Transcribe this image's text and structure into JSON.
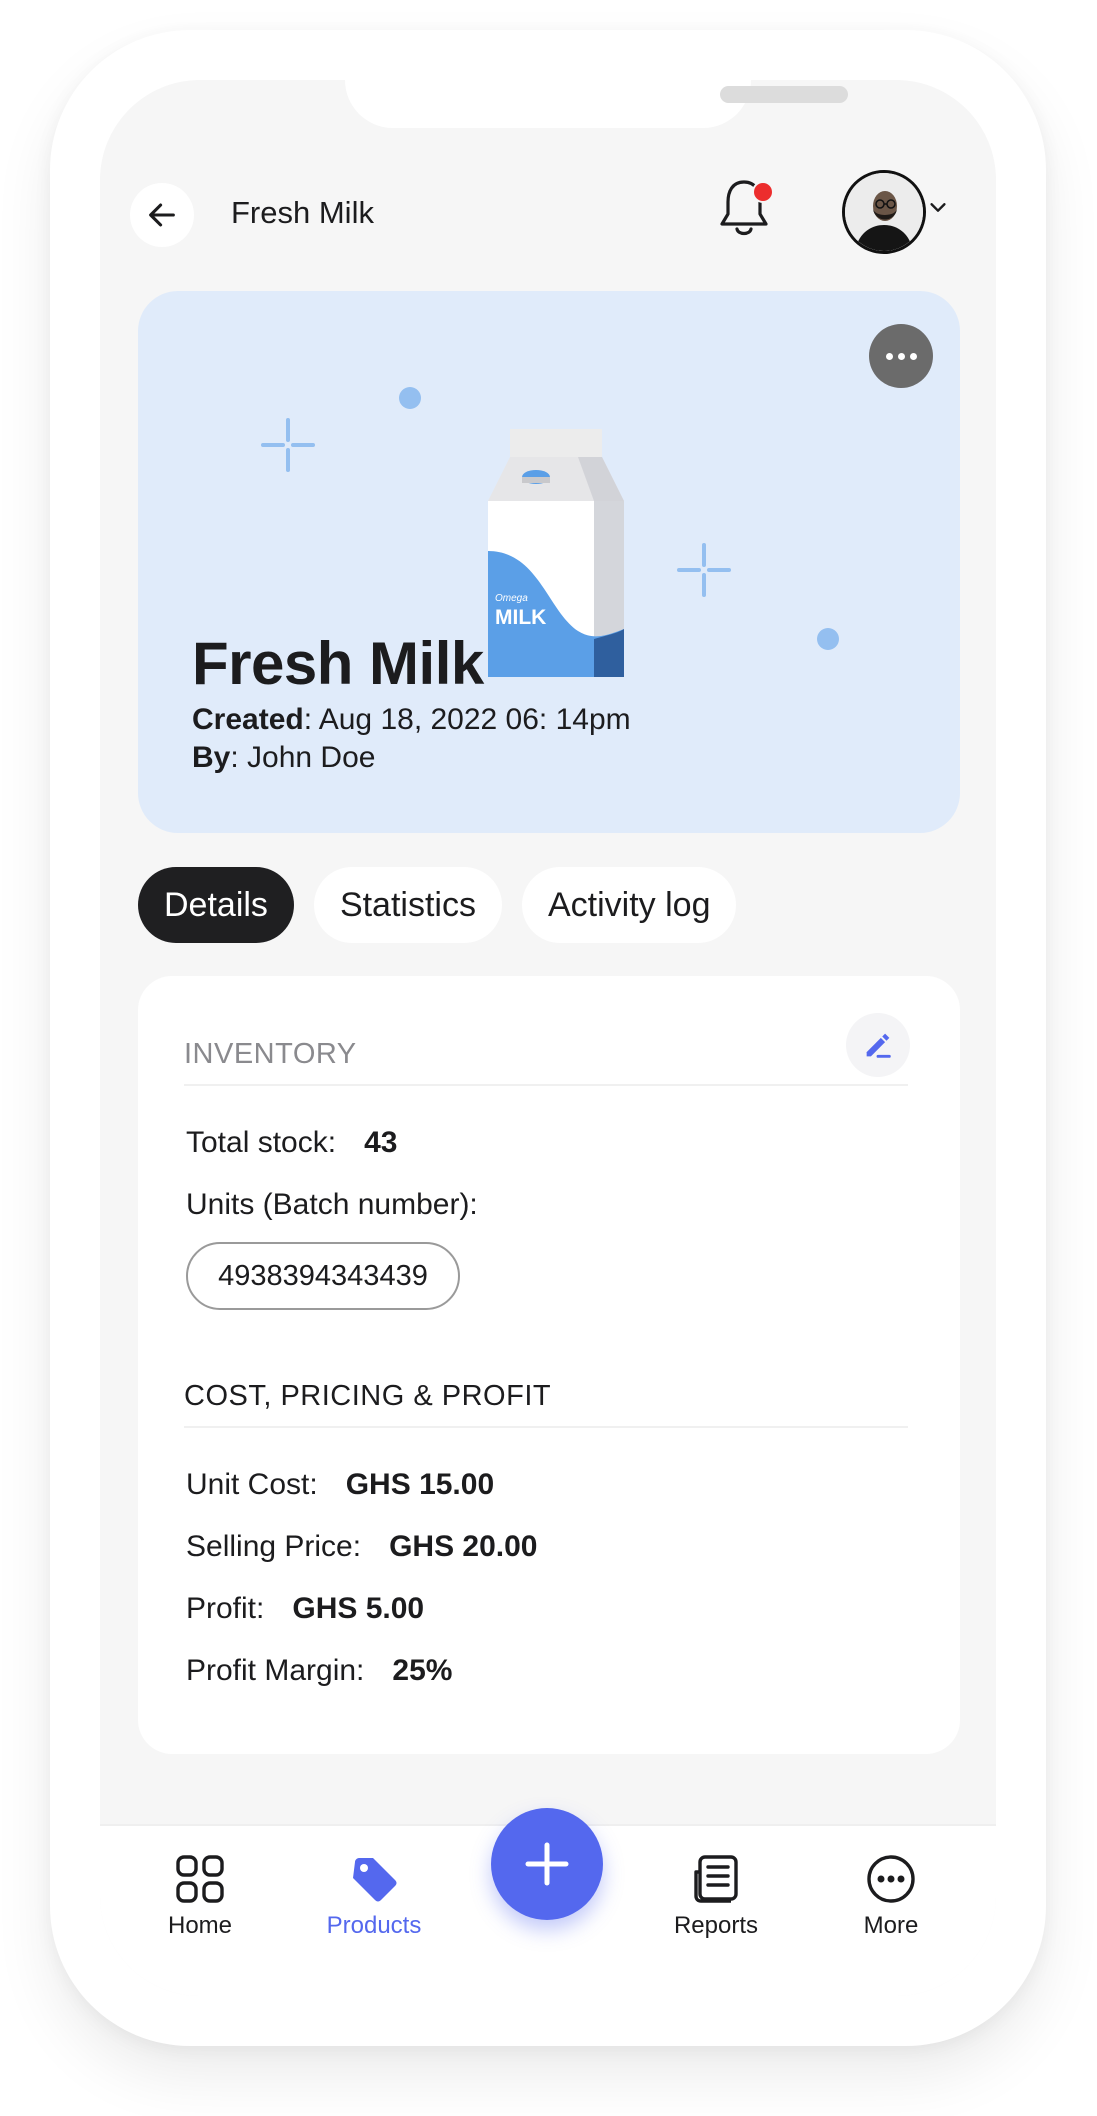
{
  "header": {
    "title": "Fresh Milk",
    "notification_badge": true,
    "avatar_icon": "user-avatar",
    "back_icon": "arrow-left-icon"
  },
  "product": {
    "name": "Fresh Milk",
    "created_label": "Created",
    "created_value": ": Aug 18, 2022 06: 14pm",
    "by_label": "By",
    "by_value": ": John Doe",
    "carton_brand_small": "Omega",
    "carton_brand_big": "MILK"
  },
  "tabs": [
    {
      "label": "Details",
      "active": true
    },
    {
      "label": "Statistics",
      "active": false
    },
    {
      "label": "Activity log",
      "active": false
    }
  ],
  "inventory": {
    "title": "INVENTORY",
    "total_stock_label": "Total stock:",
    "total_stock_value": "43",
    "units_label": "Units (Batch number):",
    "batch_number": "4938394343439"
  },
  "pricing": {
    "title": "COST, PRICING & PROFIT",
    "unit_cost_label": "Unit Cost:",
    "unit_cost_value": "GHS 15.00",
    "selling_price_label": "Selling Price:",
    "selling_price_value": "GHS 20.00",
    "profit_label": "Profit:",
    "profit_value": "GHS 5.00",
    "margin_label": "Profit Margin:",
    "margin_value": "25%"
  },
  "nav": {
    "home": "Home",
    "products": "Products",
    "reports": "Reports",
    "more": "More",
    "active": "Products"
  },
  "colors": {
    "accent": "#5468ee",
    "hero_bg": "#e0ebfa",
    "milk_blue": "#5b9fe7",
    "badge_red": "#ec2d2d",
    "active_tab": "#1f1f21"
  }
}
